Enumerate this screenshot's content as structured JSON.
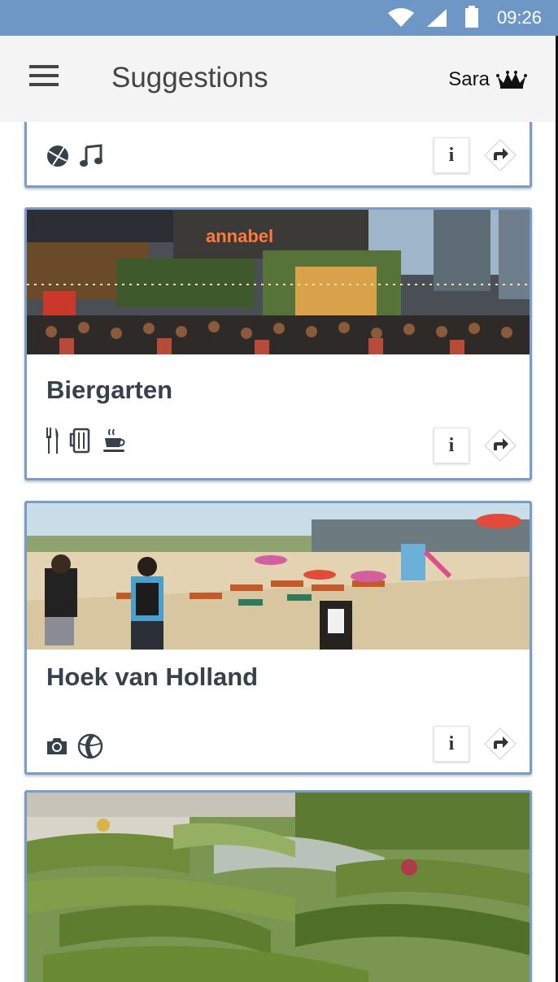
{
  "status_bar": {
    "time": "09:26"
  },
  "app_bar": {
    "title": "Suggestions",
    "user_name": "Sara"
  },
  "cards": [
    {
      "title": "",
      "icons": [
        "ball-icon",
        "music-note-icon"
      ],
      "info_label": "i"
    },
    {
      "title": "Biergarten",
      "icons": [
        "fork-knife-icon",
        "beer-mug-icon",
        "coffee-cup-icon"
      ],
      "info_label": "i"
    },
    {
      "title": "Hoek van Holland",
      "icons": [
        "camera-icon",
        "beach-ball-icon"
      ],
      "info_label": "i"
    },
    {
      "title": "",
      "icons": [],
      "info_label": ""
    }
  ],
  "colors": {
    "status_bar": "#6f97c6",
    "card_border": "#7b9cc7",
    "app_bar": "#f4f4f4",
    "title_text": "#37414b"
  }
}
